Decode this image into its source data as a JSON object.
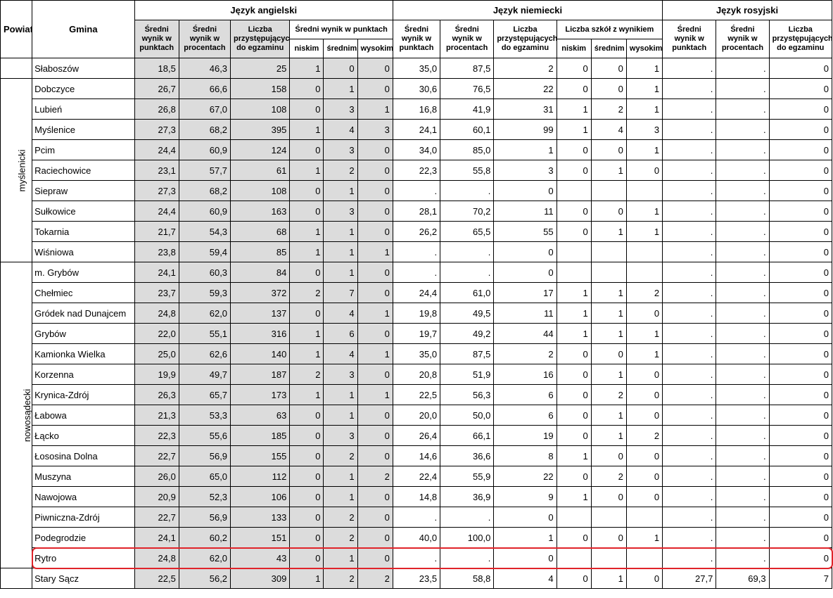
{
  "headers": {
    "powiat": "Powiat",
    "gmina": "Gmina",
    "angielski": "Język angielski",
    "niemiecki": "Język niemiecki",
    "rosyjski": "Język rosyjski",
    "sredni_pkt": "Średni wynik w punktach",
    "sredni_proc": "Średni wynik w procentach",
    "liczba": "Liczba przystępujących do egzaminu",
    "sredni_wynik_pkt_group": "Średni wynik w punktach",
    "liczba_szkol": "Liczba szkół z wynikiem",
    "niskim": "niskim",
    "srednim": "średnim",
    "wysokim": "wysokim"
  },
  "groups": [
    {
      "powiat": "",
      "rows": [
        [
          "Słaboszów",
          "18,5",
          "46,3",
          "25",
          "1",
          "0",
          "0",
          "35,0",
          "87,5",
          "2",
          "0",
          "0",
          "1",
          ".",
          ".",
          "0"
        ]
      ]
    },
    {
      "powiat": "myślenicki",
      "rows": [
        [
          "Dobczyce",
          "26,7",
          "66,6",
          "158",
          "0",
          "1",
          "0",
          "30,6",
          "76,5",
          "22",
          "0",
          "0",
          "1",
          ".",
          ".",
          "0"
        ],
        [
          "Lubień",
          "26,8",
          "67,0",
          "108",
          "0",
          "3",
          "1",
          "16,8",
          "41,9",
          "31",
          "1",
          "2",
          "1",
          ".",
          ".",
          "0"
        ],
        [
          "Myślenice",
          "27,3",
          "68,2",
          "395",
          "1",
          "4",
          "3",
          "24,1",
          "60,1",
          "99",
          "1",
          "4",
          "3",
          ".",
          ".",
          "0"
        ],
        [
          "Pcim",
          "24,4",
          "60,9",
          "124",
          "0",
          "3",
          "0",
          "34,0",
          "85,0",
          "1",
          "0",
          "0",
          "1",
          ".",
          ".",
          "0"
        ],
        [
          "Raciechowice",
          "23,1",
          "57,7",
          "61",
          "1",
          "2",
          "0",
          "22,3",
          "55,8",
          "3",
          "0",
          "1",
          "0",
          ".",
          ".",
          "0"
        ],
        [
          "Siepraw",
          "27,3",
          "68,2",
          "108",
          "0",
          "1",
          "0",
          ".",
          ".",
          "0",
          "",
          "",
          "",
          ".",
          ".",
          "0"
        ],
        [
          "Sułkowice",
          "24,4",
          "60,9",
          "163",
          "0",
          "3",
          "0",
          "28,1",
          "70,2",
          "11",
          "0",
          "0",
          "1",
          ".",
          ".",
          "0"
        ],
        [
          "Tokarnia",
          "21,7",
          "54,3",
          "68",
          "1",
          "1",
          "0",
          "26,2",
          "65,5",
          "55",
          "0",
          "1",
          "1",
          ".",
          ".",
          "0"
        ],
        [
          "Wiśniowa",
          "23,8",
          "59,4",
          "85",
          "1",
          "1",
          "1",
          ".",
          ".",
          "0",
          "",
          "",
          "",
          ".",
          ".",
          "0"
        ]
      ]
    },
    {
      "powiat": "nowosądecki",
      "rows": [
        [
          "m. Grybów",
          "24,1",
          "60,3",
          "84",
          "0",
          "1",
          "0",
          ".",
          ".",
          "0",
          "",
          "",
          "",
          ".",
          ".",
          "0"
        ],
        [
          "Chełmiec",
          "23,7",
          "59,3",
          "372",
          "2",
          "7",
          "0",
          "24,4",
          "61,0",
          "17",
          "1",
          "1",
          "2",
          ".",
          ".",
          "0"
        ],
        [
          "Gródek nad Dunajcem",
          "24,8",
          "62,0",
          "137",
          "0",
          "4",
          "1",
          "19,8",
          "49,5",
          "11",
          "1",
          "1",
          "0",
          ".",
          ".",
          "0"
        ],
        [
          "Grybów",
          "22,0",
          "55,1",
          "316",
          "1",
          "6",
          "0",
          "19,7",
          "49,2",
          "44",
          "1",
          "1",
          "1",
          ".",
          ".",
          "0"
        ],
        [
          "Kamionka Wielka",
          "25,0",
          "62,6",
          "140",
          "1",
          "4",
          "1",
          "35,0",
          "87,5",
          "2",
          "0",
          "0",
          "1",
          ".",
          ".",
          "0"
        ],
        [
          "Korzenna",
          "19,9",
          "49,7",
          "187",
          "2",
          "3",
          "0",
          "20,8",
          "51,9",
          "16",
          "0",
          "1",
          "0",
          ".",
          ".",
          "0"
        ],
        [
          "Krynica-Zdrój",
          "26,3",
          "65,7",
          "173",
          "1",
          "1",
          "1",
          "22,5",
          "56,3",
          "6",
          "0",
          "2",
          "0",
          ".",
          ".",
          "0"
        ],
        [
          "Łabowa",
          "21,3",
          "53,3",
          "63",
          "0",
          "1",
          "0",
          "20,0",
          "50,0",
          "6",
          "0",
          "1",
          "0",
          ".",
          ".",
          "0"
        ],
        [
          "Łącko",
          "22,3",
          "55,6",
          "185",
          "0",
          "3",
          "0",
          "26,4",
          "66,1",
          "19",
          "0",
          "1",
          "2",
          ".",
          ".",
          "0"
        ],
        [
          "Łososina Dolna",
          "22,7",
          "56,9",
          "155",
          "0",
          "2",
          "0",
          "14,6",
          "36,6",
          "8",
          "1",
          "0",
          "0",
          ".",
          ".",
          "0"
        ],
        [
          "Muszyna",
          "26,0",
          "65,0",
          "112",
          "0",
          "1",
          "2",
          "22,4",
          "55,9",
          "22",
          "0",
          "2",
          "0",
          ".",
          ".",
          "0"
        ],
        [
          "Nawojowa",
          "20,9",
          "52,3",
          "106",
          "0",
          "1",
          "0",
          "14,8",
          "36,9",
          "9",
          "1",
          "0",
          "0",
          ".",
          ".",
          "0"
        ],
        [
          "Piwniczna-Zdrój",
          "22,7",
          "56,9",
          "133",
          "0",
          "2",
          "0",
          ".",
          ".",
          "0",
          "",
          "",
          "",
          ".",
          ".",
          "0"
        ],
        [
          "Podegrodzie",
          "24,1",
          "60,2",
          "151",
          "0",
          "2",
          "0",
          "40,0",
          "100,0",
          "1",
          "0",
          "0",
          "1",
          ".",
          ".",
          "0"
        ],
        [
          "Rytro",
          "24,8",
          "62,0",
          "43",
          "0",
          "1",
          "0",
          ".",
          ".",
          "0",
          "",
          "",
          "",
          ".",
          ".",
          "0"
        ]
      ]
    },
    {
      "powiat": "",
      "rows": [
        [
          "Stary Sącz",
          "22,5",
          "56,2",
          "309",
          "1",
          "2",
          "2",
          "23,5",
          "58,8",
          "4",
          "0",
          "1",
          "0",
          "27,7",
          "69,3",
          "7"
        ]
      ]
    }
  ],
  "highlight_row": "Rytro",
  "colors": {
    "grey": "#dcdcdc",
    "highlight": "#e0242a"
  }
}
